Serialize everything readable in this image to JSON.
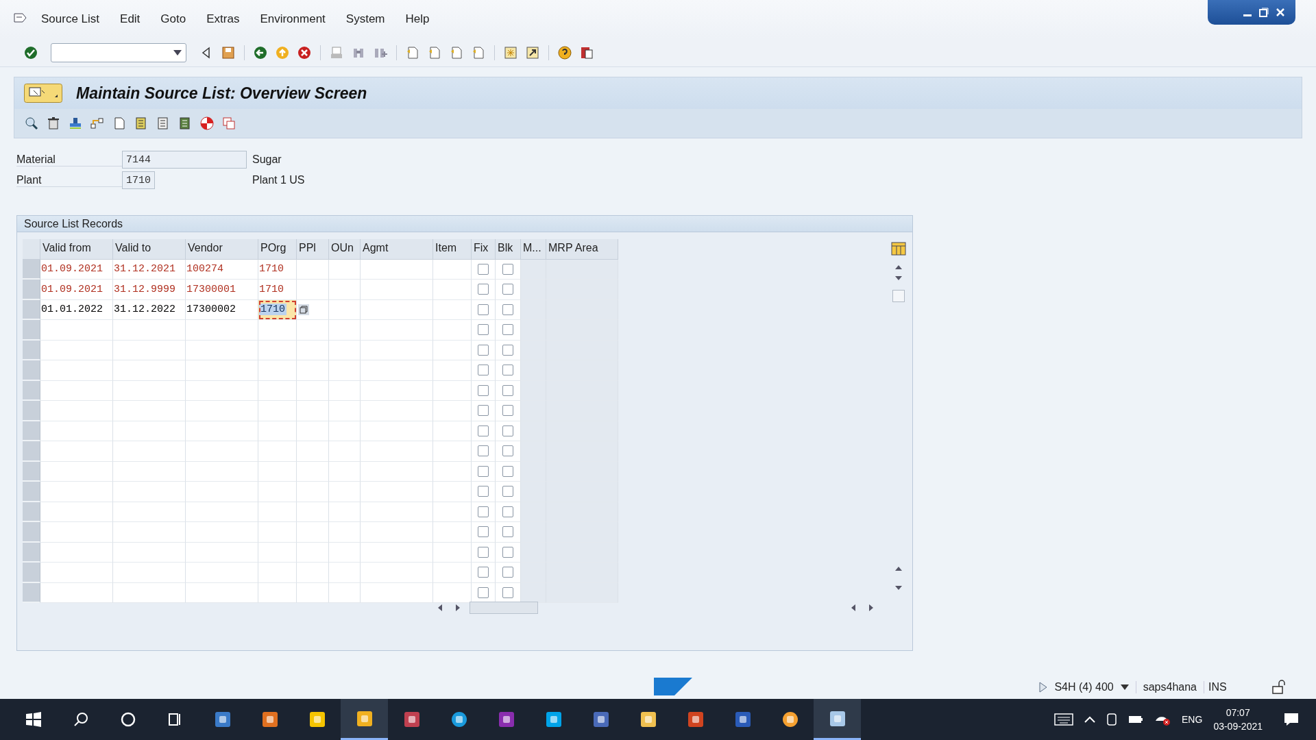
{
  "menu": [
    {
      "label": "Source List"
    },
    {
      "label": "Edit"
    },
    {
      "label": "Goto"
    },
    {
      "label": "Extras"
    },
    {
      "label": "Environment"
    },
    {
      "label": "System"
    },
    {
      "label": "Help"
    }
  ],
  "title": "Maintain Source List: Overview Screen",
  "header_fields": [
    {
      "label": "Material",
      "value": "7144",
      "description": "Sugar"
    },
    {
      "label": "Plant",
      "value": "1710",
      "description": "Plant 1 US"
    }
  ],
  "table": {
    "title": "Source List Records",
    "columns": [
      "Valid from",
      "Valid to",
      "Vendor",
      "POrg",
      "PPl",
      "OUn",
      "Agmt",
      "Item",
      "Fix",
      "Blk",
      "M...",
      "MRP Area"
    ],
    "rows": [
      {
        "valid_from": "01.09.2021",
        "valid_to": "31.12.2021",
        "vendor": "100274",
        "porg": "1710",
        "color": "#b03020",
        "fix": false,
        "blk": false,
        "selected": false
      },
      {
        "valid_from": "01.09.2021",
        "valid_to": "31.12.9999",
        "vendor": "17300001",
        "porg": "1710",
        "color": "#b03020",
        "fix": false,
        "blk": false,
        "selected": false
      },
      {
        "valid_from": "01.01.2022",
        "valid_to": "31.12.2022",
        "vendor": "17300002",
        "porg": "1710",
        "color": "#000000",
        "fix": false,
        "blk": false,
        "selected": true
      },
      {
        "fix": false,
        "blk": false,
        "selected": false
      },
      {
        "fix": false,
        "blk": false,
        "selected": false
      },
      {
        "fix": false,
        "blk": false,
        "selected": false
      },
      {
        "fix": false,
        "blk": false,
        "selected": false
      },
      {
        "fix": false,
        "blk": false,
        "selected": false
      },
      {
        "fix": false,
        "blk": false,
        "selected": false
      },
      {
        "fix": false,
        "blk": false,
        "selected": false
      },
      {
        "fix": false,
        "blk": false,
        "selected": false
      },
      {
        "fix": false,
        "blk": false,
        "selected": false
      },
      {
        "fix": false,
        "blk": false,
        "selected": false
      },
      {
        "fix": false,
        "blk": false,
        "selected": false
      },
      {
        "fix": false,
        "blk": false,
        "selected": false
      },
      {
        "fix": false,
        "blk": false,
        "selected": false
      },
      {
        "fix": false,
        "blk": false,
        "selected": false
      }
    ]
  },
  "status_bar": {
    "system": "S4H (4) 400",
    "server": "saps4hana",
    "mode": "INS"
  },
  "taskbar": {
    "language": "ENG",
    "time": "07:07",
    "date": "03-09-2021"
  }
}
